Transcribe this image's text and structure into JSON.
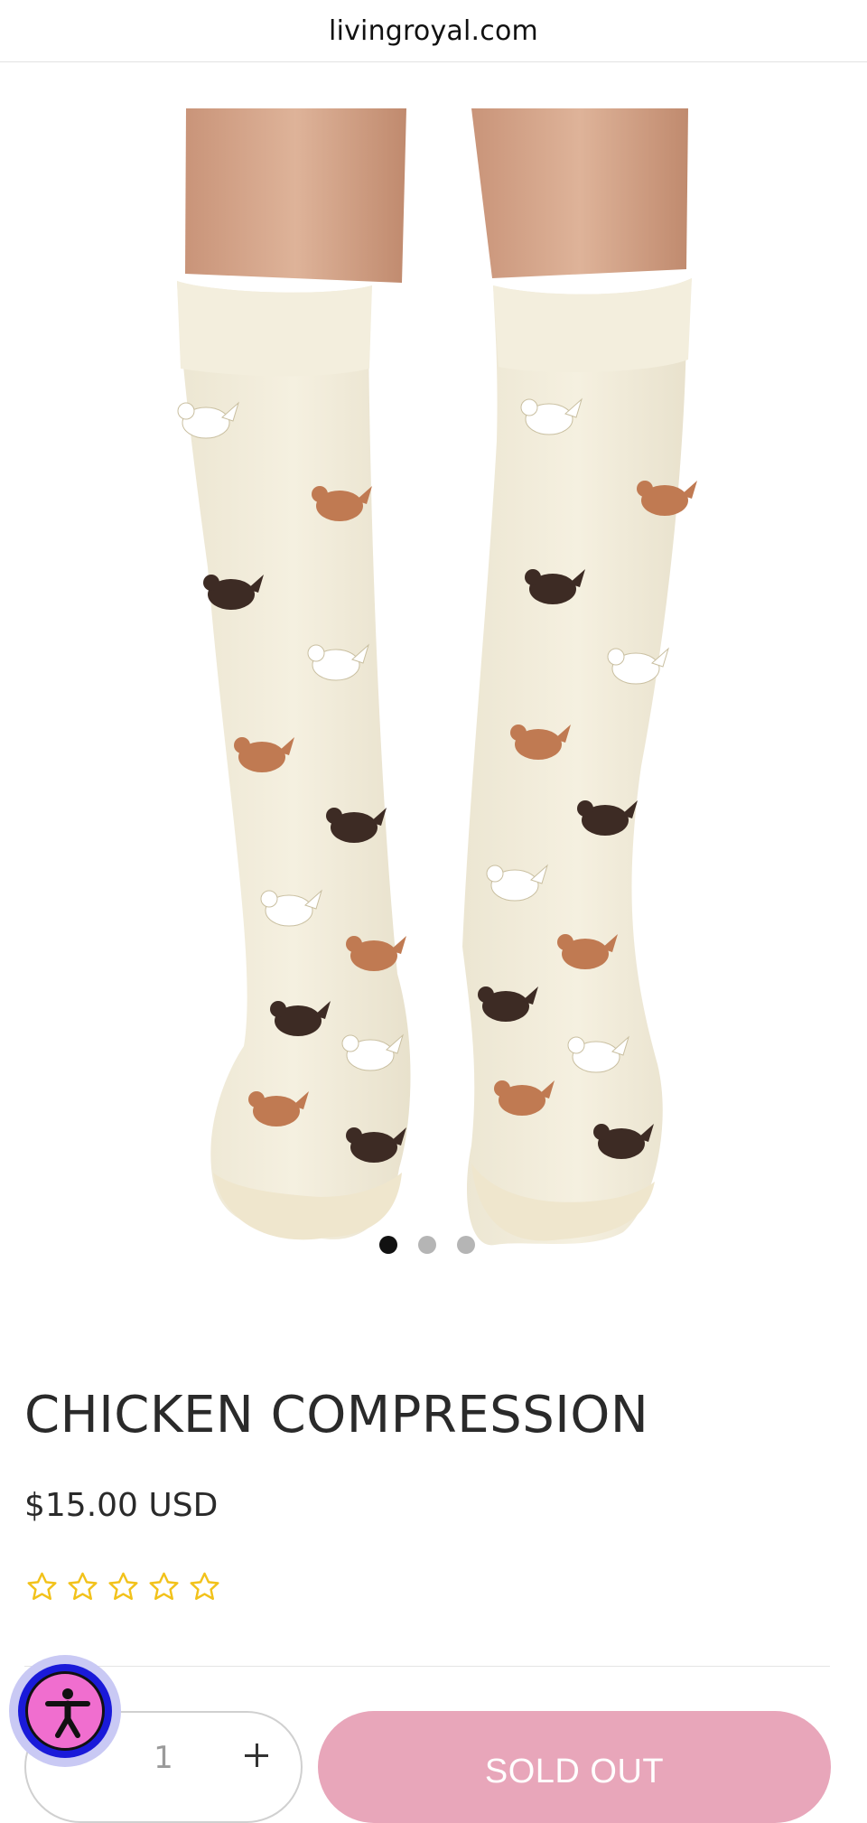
{
  "browser": {
    "url": "livingroyal.com"
  },
  "gallery": {
    "image_alt": "Chicken pattern compression socks",
    "slide_count": 3,
    "active_slide": 1
  },
  "product": {
    "title": "CHICKEN COMPRESSION",
    "price": "$15.00 USD",
    "rating": {
      "value": 0,
      "max": 5,
      "star_color": "#f2c21b"
    }
  },
  "purchase": {
    "quantity_minus": "−",
    "quantity_value": "1",
    "quantity_plus": "+",
    "button_label": "SOLD OUT",
    "button_color": "#e8a6ba"
  },
  "accessibility_widget": {
    "icon": "accessibility-person-icon"
  }
}
